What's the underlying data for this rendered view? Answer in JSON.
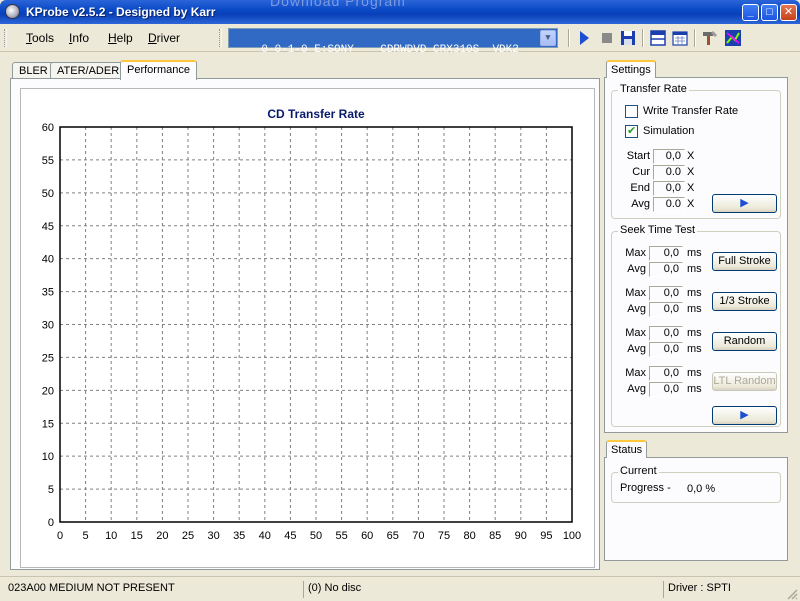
{
  "window": {
    "title": "KProbe v2.5.2 - Designed by Karr",
    "background_ghost_text": "Download Program",
    "controls": {
      "minimize": "_",
      "maximize": "□",
      "close": "✕"
    }
  },
  "menu": {
    "items": [
      {
        "label": "Tools",
        "hotkey": "T",
        "rest": "ools"
      },
      {
        "label": "Info",
        "hotkey": "I",
        "rest": "nfo"
      },
      {
        "label": "Help",
        "hotkey": "H",
        "rest": "elp"
      },
      {
        "label": "Driver",
        "hotkey": "D",
        "rest": "river"
      }
    ]
  },
  "drive_select": {
    "value": "0-0-1-0 E:SONY    CDRWDVD CRX310S  VDK2"
  },
  "toolbar": {
    "icons": [
      "play-icon",
      "stop-icon",
      "save-icon",
      "layout-icon",
      "calendar-icon",
      "tools-icon",
      "chart-export-icon"
    ]
  },
  "tabs": [
    {
      "label": "BLER",
      "active": false
    },
    {
      "label": "ATER/ADER",
      "active": false
    },
    {
      "label": "Performance",
      "active": true
    }
  ],
  "chart_data": {
    "type": "line",
    "title": "CD Transfer Rate",
    "xlabel": "",
    "ylabel": "",
    "xlim": [
      0,
      100
    ],
    "ylim": [
      0,
      60
    ],
    "x_ticks": [
      0,
      5,
      10,
      15,
      20,
      25,
      30,
      35,
      40,
      45,
      50,
      55,
      60,
      65,
      70,
      75,
      80,
      85,
      90,
      95,
      100
    ],
    "y_ticks": [
      0,
      5,
      10,
      15,
      20,
      25,
      30,
      35,
      40,
      45,
      50,
      55,
      60
    ],
    "grid": true,
    "series": []
  },
  "settings": {
    "tab_label": "Settings",
    "transfer_rate": {
      "title": "Transfer Rate",
      "write_transfer_rate": {
        "label": "Write Transfer Rate",
        "checked": false
      },
      "simulation": {
        "label": "Simulation",
        "checked": true
      },
      "rows": [
        {
          "label": "Start",
          "value": "0,0",
          "unit": "X"
        },
        {
          "label": "Cur",
          "value": "0.0",
          "unit": "X"
        },
        {
          "label": "End",
          "value": "0,0",
          "unit": "X"
        },
        {
          "label": "Avg",
          "value": "0.0",
          "unit": "X"
        }
      ],
      "play_label": "▶"
    },
    "seek_time_test": {
      "title": "Seek Time Test",
      "tests": [
        {
          "max": "0,0",
          "avg": "0,0",
          "button": "Full Stroke",
          "enabled": true
        },
        {
          "max": "0,0",
          "avg": "0,0",
          "button": "1/3 Stroke",
          "enabled": true
        },
        {
          "max": "0,0",
          "avg": "0,0",
          "button": "Random",
          "enabled": true
        },
        {
          "max": "0,0",
          "avg": "0,0",
          "button": "LTL Random",
          "enabled": false
        }
      ],
      "max_label": "Max",
      "avg_label": "Avg",
      "unit": "ms",
      "play_label": "▶"
    }
  },
  "status_panel": {
    "tab_label": "Status",
    "group_title": "Current",
    "progress_label": "Progress -",
    "progress_value": "0,0 %"
  },
  "statusbar": {
    "message": "023A00 MEDIUM NOT PRESENT",
    "disc": "(0) No disc",
    "driver": "Driver : SPTI"
  }
}
